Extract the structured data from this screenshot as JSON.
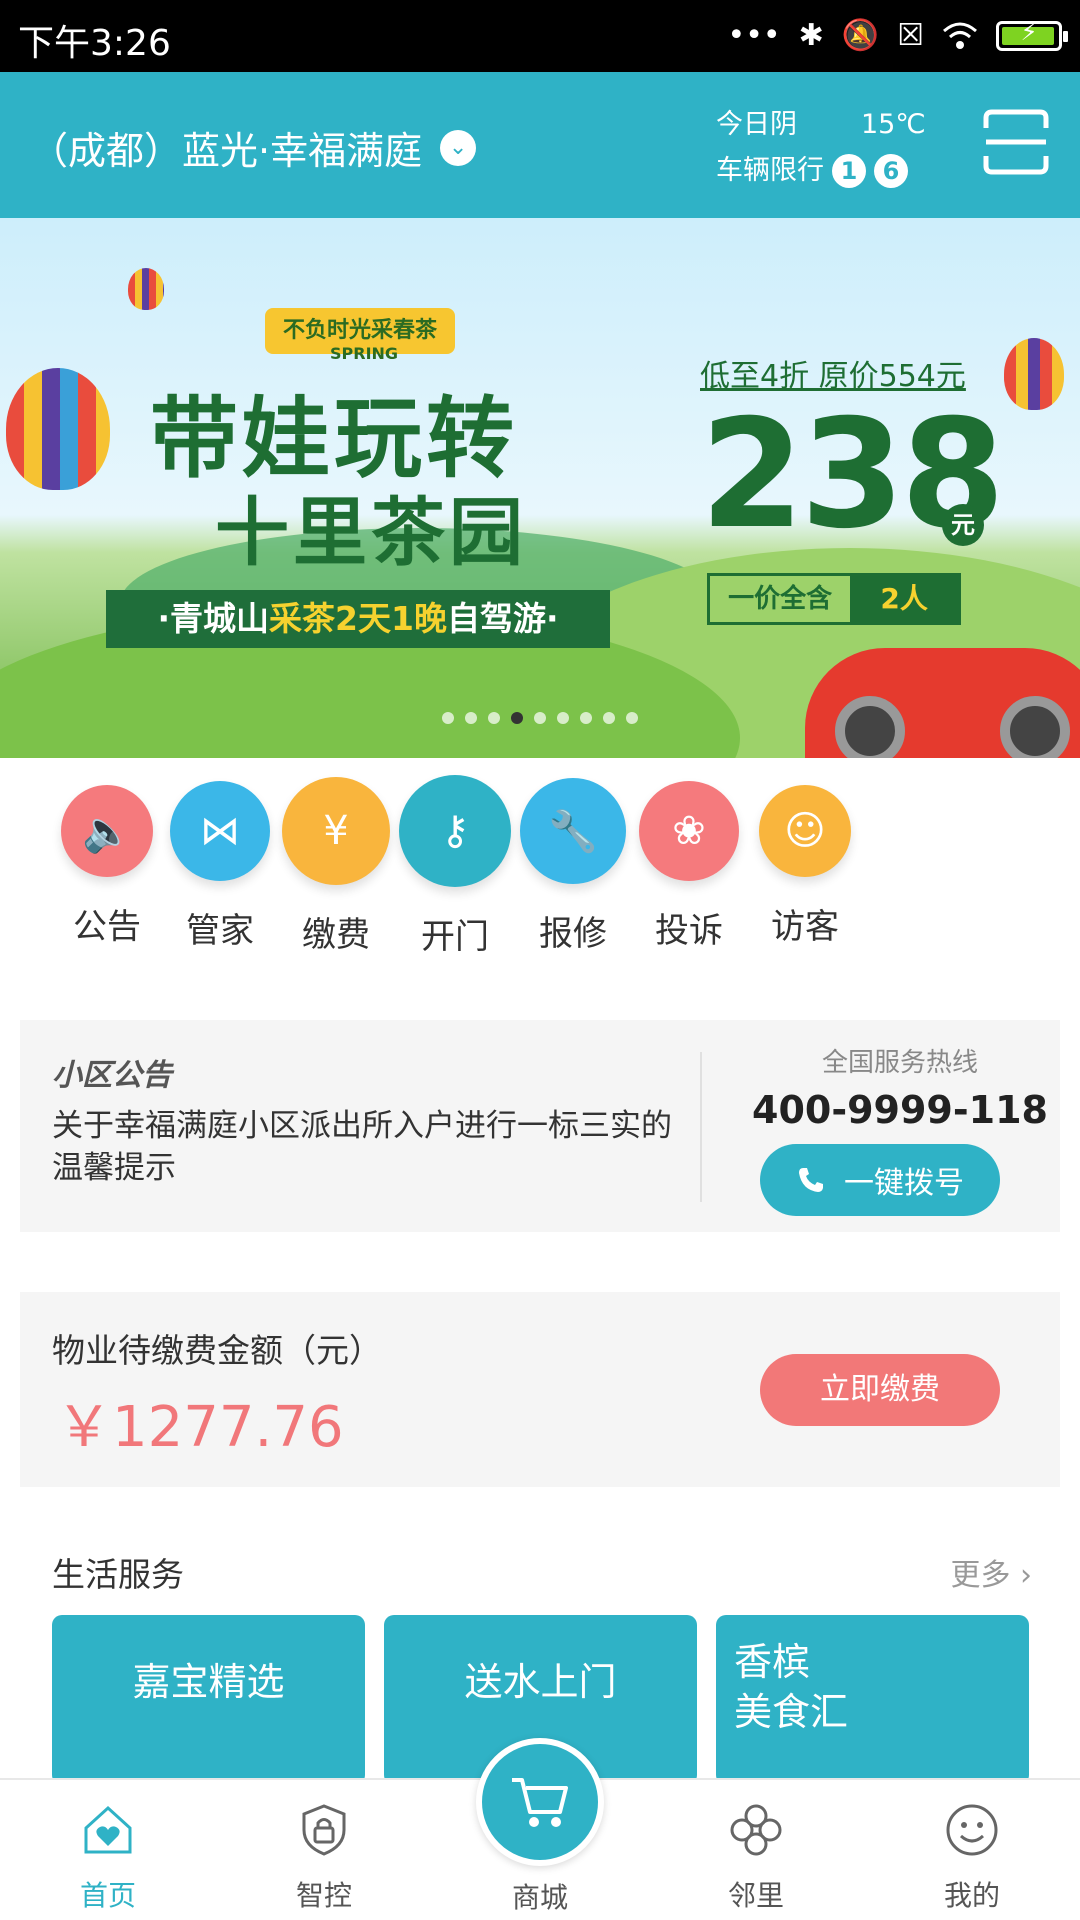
{
  "status_bar": {
    "time": "下午3:26"
  },
  "header": {
    "community": "（成都）蓝光·幸福满庭",
    "weather_label": "今日阴",
    "temperature": "15℃",
    "traffic_label": "车辆限行",
    "plates": [
      "1",
      "6"
    ]
  },
  "banner": {
    "ribbon": "不负时光采春茶",
    "spring": "SPRING",
    "title_line1": "带娃玩转",
    "title_line2": "十里茶园",
    "subtitle_a": "·青城山",
    "subtitle_b": "采茶2天1晚",
    "subtitle_c": "自驾游·",
    "price_note": "低至4折 原价554元",
    "price": "238",
    "price_unit": "元",
    "deal_a": "一价全含",
    "deal_b": "2人",
    "slide_count": 9,
    "active_slide": 3
  },
  "menu": [
    {
      "label": "公告",
      "color": "#f57a7d",
      "icon": "speaker-icon"
    },
    {
      "label": "管家",
      "color": "#3bb7e8",
      "icon": "butler-icon"
    },
    {
      "label": "缴费",
      "color": "#f9b53d",
      "icon": "money-bag-icon"
    },
    {
      "label": "开门",
      "color": "#2fb2c6",
      "icon": "key-icon"
    },
    {
      "label": "报修",
      "color": "#3bb7e8",
      "icon": "wrench-icon"
    },
    {
      "label": "投诉",
      "color": "#f57a7d",
      "icon": "lotus-icon"
    },
    {
      "label": "访客",
      "color": "#f9b53d",
      "icon": "visitor-icon"
    }
  ],
  "notice": {
    "tag": "小区公告",
    "text": "关于幸福满庭小区派出所入户进行一标三实的温馨提示",
    "hotline_label": "全国服务热线",
    "hotline": "400-9999-118",
    "call_button": "一键拨号"
  },
  "fee": {
    "label": "物业待缴费金额（元）",
    "amount": "￥1277.76",
    "pay_button": "立即缴费"
  },
  "life": {
    "title": "生活服务",
    "more": "更多",
    "cards": [
      "嘉宝精选",
      "送水上门",
      "香槟\n美食汇"
    ]
  },
  "tabs": [
    {
      "label": "首页",
      "active": true
    },
    {
      "label": "智控",
      "active": false
    },
    {
      "label": "商城",
      "active": false
    },
    {
      "label": "邻里",
      "active": false
    },
    {
      "label": "我的",
      "active": false
    }
  ],
  "colors": {
    "primary": "#2fb2c6",
    "alert": "#f27878"
  }
}
